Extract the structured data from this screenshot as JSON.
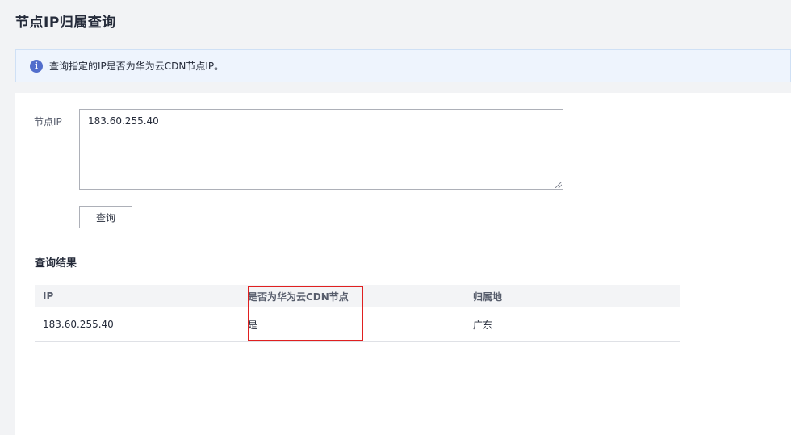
{
  "page": {
    "title": "节点IP归属查询"
  },
  "notice": {
    "icon": "info-icon",
    "icon_glyph": "i",
    "text": "查询指定的IP是否为华为云CDN节点IP。"
  },
  "form": {
    "ip_label": "节点IP",
    "ip_value": "183.60.255.40",
    "query_label": "查询"
  },
  "results": {
    "title": "查询结果",
    "columns": [
      "IP",
      "是否为华为云CDN节点",
      "归属地"
    ],
    "rows": [
      {
        "ip": "183.60.255.40",
        "is_cdn": "是",
        "location": "广东"
      }
    ]
  },
  "colors": {
    "accent": "#526ecc",
    "highlight": "#e02020",
    "info_bg": "#eef4fd"
  }
}
